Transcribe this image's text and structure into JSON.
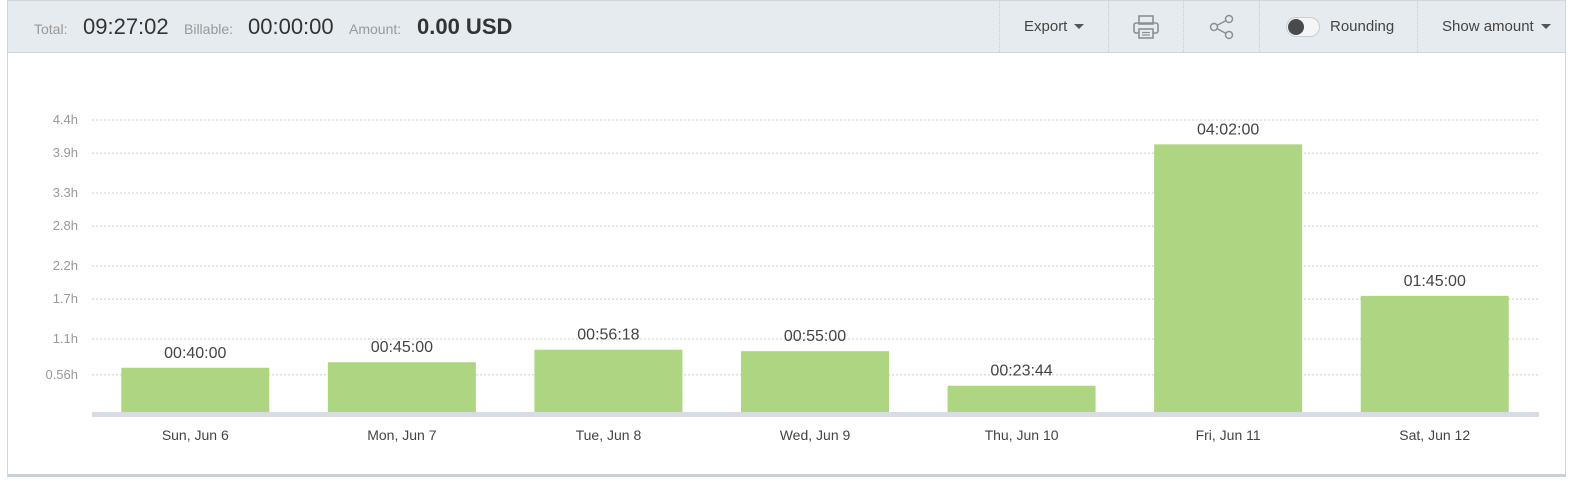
{
  "toolbar": {
    "total_label": "Total:",
    "total_value": "09:27:02",
    "billable_label": "Billable:",
    "billable_value": "00:00:00",
    "amount_label": "Amount:",
    "amount_value": "0.00 USD",
    "export_label": "Export",
    "print_icon": "printer-icon",
    "share_icon": "share-icon",
    "rounding_label": "Rounding",
    "rounding_enabled": false,
    "show_amount_label": "Show amount"
  },
  "colors": {
    "bar": "#aed581",
    "axis": "#d7dde2",
    "grid": "#cccccc",
    "tick_text": "#999999",
    "label_text": "#444444"
  },
  "chart_data": {
    "type": "bar",
    "categories": [
      "Sun, Jun 6",
      "Mon, Jun 7",
      "Tue, Jun 8",
      "Wed, Jun 9",
      "Thu, Jun 10",
      "Fri, Jun 11",
      "Sat, Jun 12"
    ],
    "values": [
      0.6667,
      0.75,
      0.9383,
      0.9167,
      0.3956,
      4.0333,
      1.75
    ],
    "data_labels": [
      "00:40:00",
      "00:45:00",
      "00:56:18",
      "00:55:00",
      "00:23:44",
      "04:02:00",
      "01:45:00"
    ],
    "y_ticks": [
      0.56,
      1.1,
      1.7,
      2.2,
      2.8,
      3.3,
      3.9,
      4.4
    ],
    "y_tick_labels": [
      "0.56h",
      "1.1h",
      "1.7h",
      "2.2h",
      "2.8h",
      "3.3h",
      "3.9h",
      "4.4h"
    ],
    "ylim": [
      0,
      4.4
    ],
    "grid": true,
    "legend": "none"
  }
}
